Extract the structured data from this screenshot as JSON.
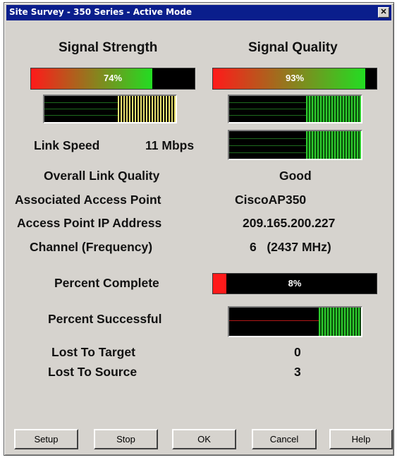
{
  "window": {
    "title": "Site Survey - 350 Series - Active Mode",
    "close_glyph": "✕"
  },
  "signal_strength": {
    "label": "Signal Strength",
    "percent_text": "74%",
    "value": 0.74
  },
  "signal_quality": {
    "label": "Signal Quality",
    "percent_text": "93%",
    "value": 0.93
  },
  "link_speed": {
    "label": "Link Speed",
    "value": "11 Mbps"
  },
  "rows": [
    {
      "label": "Overall Link Quality",
      "value": "Good"
    },
    {
      "label": "Associated Access Point",
      "value": "CiscoAP350"
    },
    {
      "label": "Access Point IP Address",
      "value": "209.165.200.227"
    },
    {
      "label": "Channel (Frequency)",
      "value": "6   (2437 MHz)"
    }
  ],
  "percent_complete": {
    "label": "Percent Complete",
    "percent_text": "8%",
    "value": 0.08
  },
  "percent_successful": {
    "label": "Percent Successful"
  },
  "lost_to_target": {
    "label": "Lost To Target",
    "value": "0"
  },
  "lost_to_source": {
    "label": "Lost To Source",
    "value": "3"
  },
  "buttons": {
    "setup": "Setup",
    "stop": "Stop",
    "ok": "OK",
    "cancel": "Cancel",
    "help": "Help"
  },
  "colors": {
    "bar_start": "#ff1a1a",
    "bar_end": "#22dd22",
    "meter_green": "#2ecc2e",
    "meter_yellow": "#e8e070"
  }
}
